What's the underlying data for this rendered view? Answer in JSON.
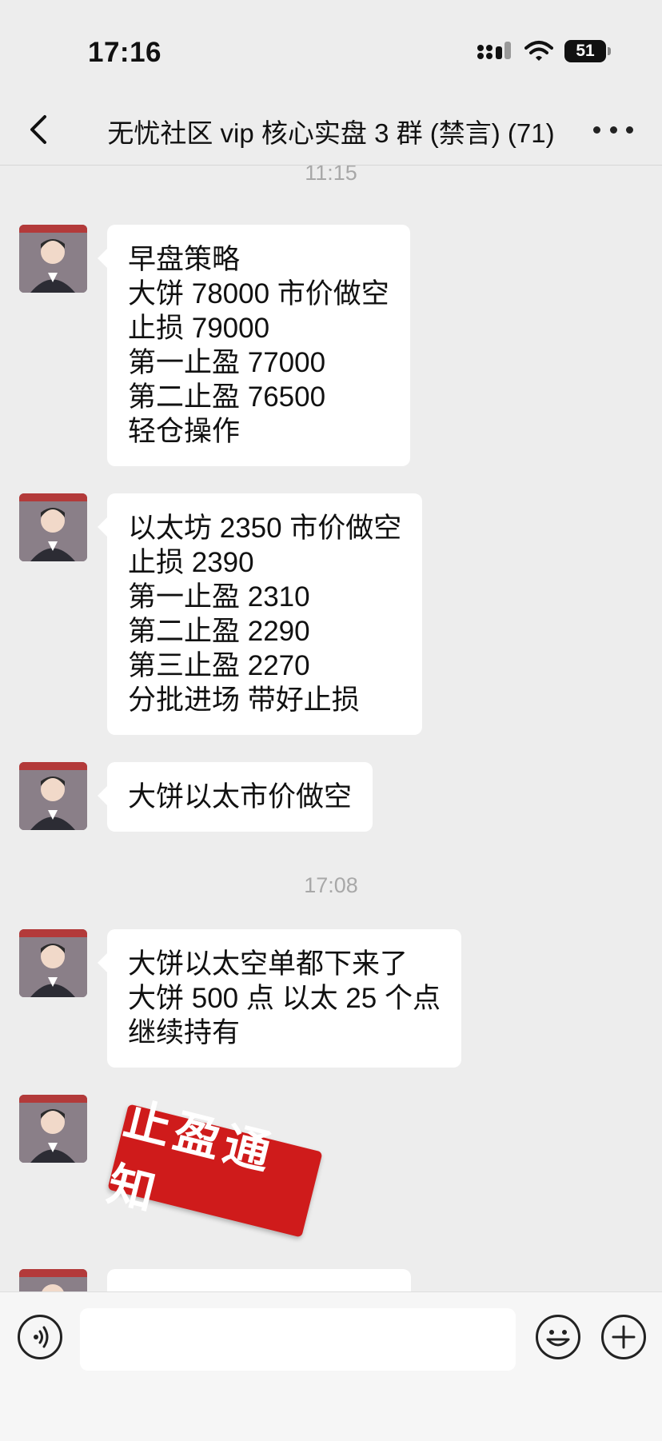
{
  "status": {
    "time": "17:16",
    "battery": "51"
  },
  "header": {
    "title": "无忧社区 vip 核心实盘 3 群 (禁言) (71)"
  },
  "timestamps": [
    "11:15",
    "17:08"
  ],
  "messages": [
    {
      "text": "早盘策略\n大饼 78000 市价做空\n止损 79000\n第一止盈 77000\n第二止盈 76500\n轻仓操作"
    },
    {
      "text": "以太坊 2350 市价做空\n止损 2390\n第一止盈 2310\n第二止盈 2290\n第三止盈 2270\n分批进场 带好止损"
    },
    {
      "text": "大饼以太市价做空"
    },
    {
      "text": "大饼以太空单都下来了\n大饼 500 点 以太 25 个点\n继续持有"
    }
  ],
  "sticker": {
    "text": "止盈通知"
  },
  "input": {
    "value": ""
  }
}
